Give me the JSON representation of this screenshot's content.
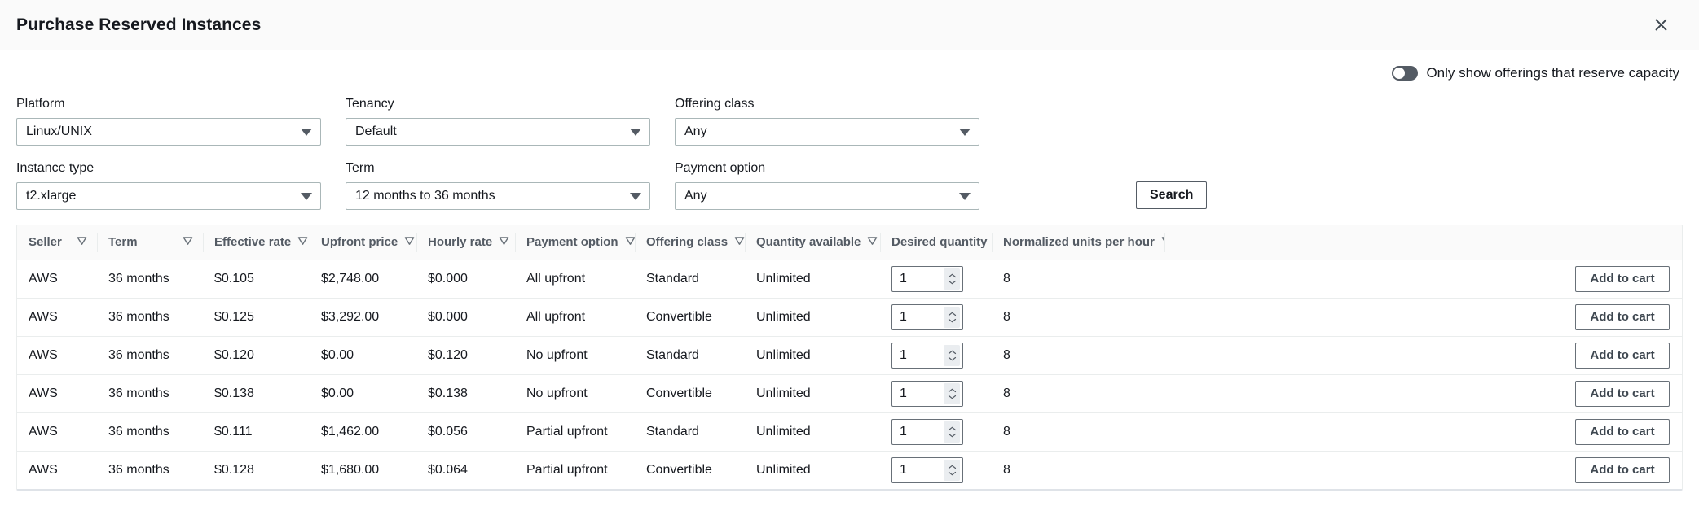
{
  "header": {
    "title": "Purchase Reserved Instances",
    "close_icon": "close-icon"
  },
  "capacity_toggle": {
    "label": "Only show offerings that reserve capacity",
    "state": "off"
  },
  "filters": {
    "platform": {
      "label": "Platform",
      "value": "Linux/UNIX"
    },
    "tenancy": {
      "label": "Tenancy",
      "value": "Default"
    },
    "offering_class": {
      "label": "Offering class",
      "value": "Any"
    },
    "instance_type": {
      "label": "Instance type",
      "value": "t2.xlarge"
    },
    "term": {
      "label": "Term",
      "value": "12 months to 36 months"
    },
    "payment_option": {
      "label": "Payment option",
      "value": "Any"
    },
    "search_button": "Search"
  },
  "table": {
    "columns": [
      {
        "label": "Seller",
        "sortable": true
      },
      {
        "label": "Term",
        "sortable": true
      },
      {
        "label": "Effective rate",
        "sortable": true
      },
      {
        "label": "Upfront price",
        "sortable": true
      },
      {
        "label": "Hourly rate",
        "sortable": true
      },
      {
        "label": "Payment option",
        "sortable": true
      },
      {
        "label": "Offering class",
        "sortable": true
      },
      {
        "label": "Quantity available",
        "sortable": true
      },
      {
        "label": "Desired quantity",
        "sortable": false
      },
      {
        "label": "Normalized units per hour",
        "sortable": true
      },
      {
        "label": "",
        "sortable": false
      }
    ],
    "action_label": "Add to cart",
    "rows": [
      {
        "seller": "AWS",
        "term": "36 months",
        "effective_rate": "$0.105",
        "upfront_price": "$2,748.00",
        "hourly_rate": "$0.000",
        "payment_option": "All upfront",
        "offering_class": "Standard",
        "quantity_available": "Unlimited",
        "desired_quantity": "1",
        "normalized_units": "8"
      },
      {
        "seller": "AWS",
        "term": "36 months",
        "effective_rate": "$0.125",
        "upfront_price": "$3,292.00",
        "hourly_rate": "$0.000",
        "payment_option": "All upfront",
        "offering_class": "Convertible",
        "quantity_available": "Unlimited",
        "desired_quantity": "1",
        "normalized_units": "8"
      },
      {
        "seller": "AWS",
        "term": "36 months",
        "effective_rate": "$0.120",
        "upfront_price": "$0.00",
        "hourly_rate": "$0.120",
        "payment_option": "No upfront",
        "offering_class": "Standard",
        "quantity_available": "Unlimited",
        "desired_quantity": "1",
        "normalized_units": "8"
      },
      {
        "seller": "AWS",
        "term": "36 months",
        "effective_rate": "$0.138",
        "upfront_price": "$0.00",
        "hourly_rate": "$0.138",
        "payment_option": "No upfront",
        "offering_class": "Convertible",
        "quantity_available": "Unlimited",
        "desired_quantity": "1",
        "normalized_units": "8"
      },
      {
        "seller": "AWS",
        "term": "36 months",
        "effective_rate": "$0.111",
        "upfront_price": "$1,462.00",
        "hourly_rate": "$0.056",
        "payment_option": "Partial upfront",
        "offering_class": "Standard",
        "quantity_available": "Unlimited",
        "desired_quantity": "1",
        "normalized_units": "8"
      },
      {
        "seller": "AWS",
        "term": "36 months",
        "effective_rate": "$0.128",
        "upfront_price": "$1,680.00",
        "hourly_rate": "$0.064",
        "payment_option": "Partial upfront",
        "offering_class": "Convertible",
        "quantity_available": "Unlimited",
        "desired_quantity": "1",
        "normalized_units": "8"
      }
    ]
  },
  "colors": {
    "header_bg": "#fafafa",
    "border": "#eaeded",
    "text": "#16191f",
    "muted": "#545b64",
    "input_border": "#aab7b8"
  }
}
